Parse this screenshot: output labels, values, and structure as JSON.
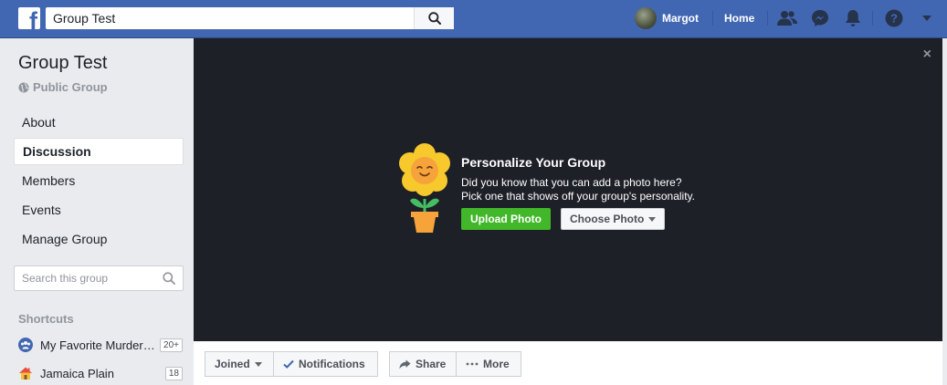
{
  "topbar": {
    "search_value": "Group Test",
    "user_name": "Margot",
    "home_label": "Home",
    "brand_color": "#4267b2"
  },
  "group": {
    "name": "Group Test",
    "privacy": "Public Group"
  },
  "nav": {
    "items": [
      {
        "label": "About",
        "active": false
      },
      {
        "label": "Discussion",
        "active": true
      },
      {
        "label": "Members",
        "active": false
      },
      {
        "label": "Events",
        "active": false
      },
      {
        "label": "Manage Group",
        "active": false
      }
    ]
  },
  "sidebar_search": {
    "placeholder": "Search this group"
  },
  "shortcuts": {
    "title": "Shortcuts",
    "items": [
      {
        "label": "My Favorite Murder Podcast",
        "count": "20+",
        "icon": "group-icon"
      },
      {
        "label": "Jamaica Plain",
        "count": "18",
        "icon": "house-icon"
      }
    ]
  },
  "cover": {
    "title": "Personalize Your Group",
    "line1": "Did you know that you can add a photo here?",
    "line2": "Pick one that shows off your group's personality.",
    "upload_label": "Upload Photo",
    "choose_label": "Choose Photo",
    "close_label": "×"
  },
  "actions": {
    "joined_label": "Joined",
    "notifications_label": "Notifications",
    "share_label": "Share",
    "more_label": "More"
  }
}
